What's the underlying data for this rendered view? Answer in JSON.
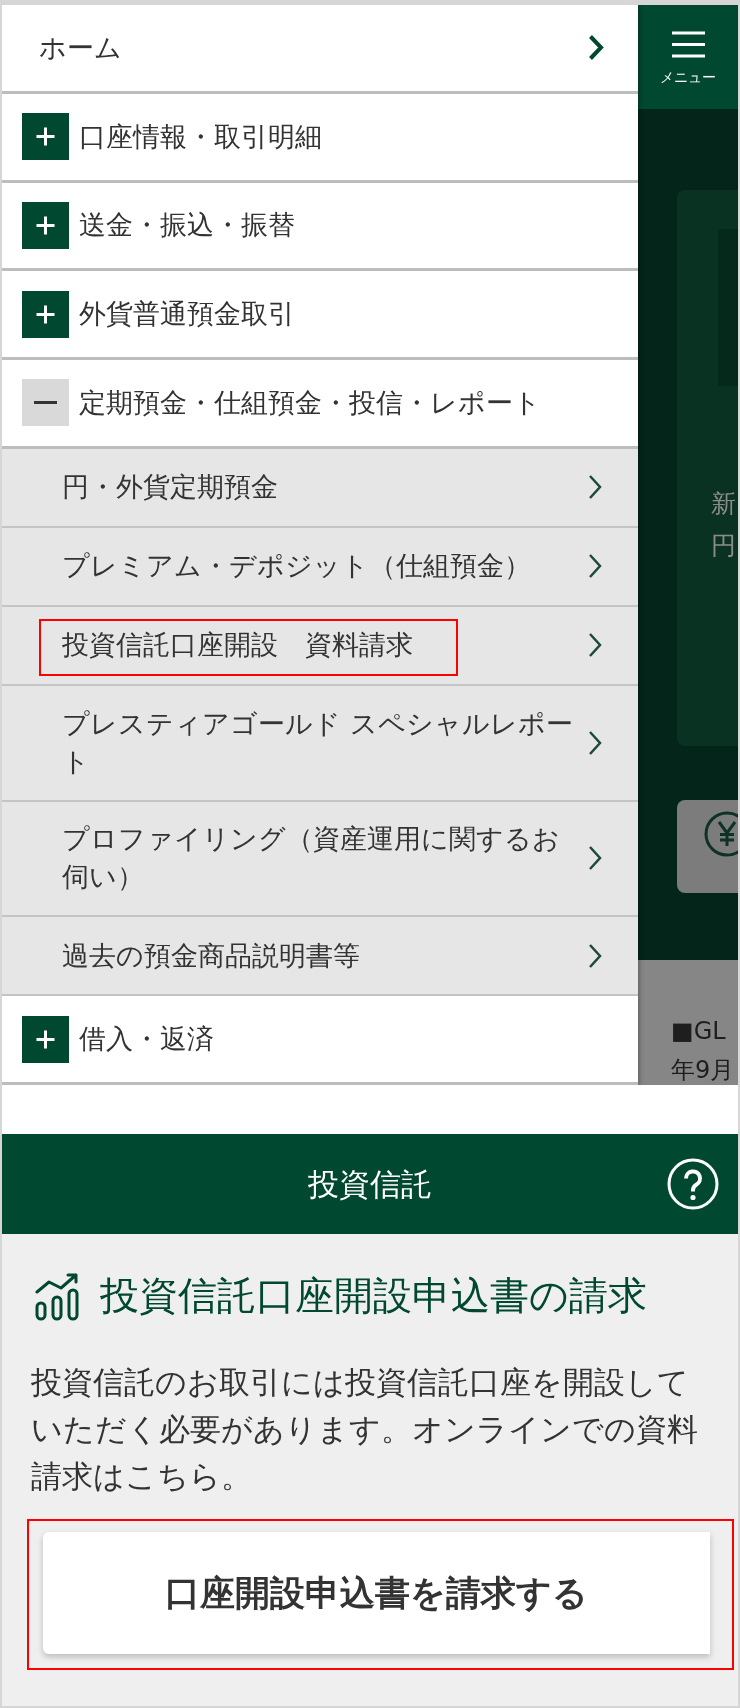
{
  "menu": {
    "items": [
      {
        "kind": "link",
        "label": "ホーム"
      },
      {
        "kind": "group",
        "label": "口座情報・取引明細",
        "expanded": false
      },
      {
        "kind": "group",
        "label": "送金・振込・振替",
        "expanded": false
      },
      {
        "kind": "group",
        "label": "外貨普通預金取引",
        "expanded": false
      },
      {
        "kind": "group",
        "label": "定期預金・仕組預金・投信・レポート",
        "expanded": true,
        "children": [
          {
            "label": "円・外貨定期預金",
            "highlighted": false
          },
          {
            "label": "プレミアム・デポジット（仕組預金）",
            "highlighted": false
          },
          {
            "label": "投資信託口座開設　資料請求",
            "highlighted": true
          },
          {
            "label": "プレスティアゴールド スペシャルレポート",
            "highlighted": false
          },
          {
            "label": "プロファイリング（資産運用に関するお伺い）",
            "highlighted": false
          },
          {
            "label": "過去の預金商品説明書等",
            "highlighted": false
          }
        ]
      },
      {
        "kind": "group",
        "label": "借入・返済",
        "expanded": false
      }
    ]
  },
  "menu_button": {
    "label": "メニュー"
  },
  "background_page": {
    "card_texts": [
      "新",
      "円"
    ],
    "banner_texts": [
      "■GL",
      "年9月"
    ]
  },
  "fund_section": {
    "title": "投資信託",
    "heading": "投資信託口座開設申込書の請求",
    "description": "投資信託のお取引には投資信託口座を開設していただく必要があります。オンラインでの資料請求はこちら。",
    "button": {
      "label": "口座開設申込書を請求する",
      "highlighted": true
    }
  }
}
